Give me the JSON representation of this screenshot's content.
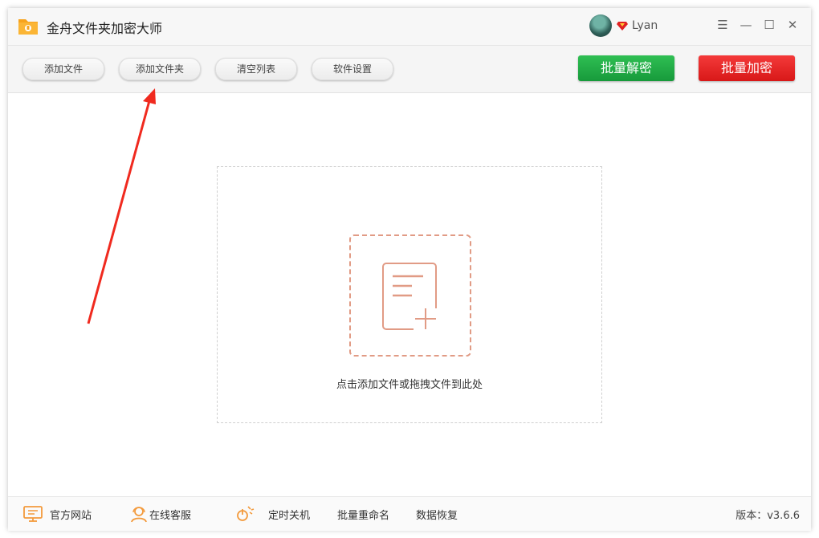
{
  "app": {
    "title": "金舟文件夹加密大师",
    "user": "Lyan"
  },
  "window_controls": {
    "menu": "☰",
    "minimize": "—",
    "maximize": "☐",
    "close": "✕"
  },
  "toolbar": {
    "add_file": "添加文件",
    "add_folder": "添加文件夹",
    "clear_list": "清空列表",
    "settings": "软件设置",
    "batch_decrypt": "批量解密",
    "batch_encrypt": "批量加密"
  },
  "main": {
    "drop_hint": "点击添加文件或拖拽文件到此处"
  },
  "footer": {
    "website": "官方网站",
    "support": "在线客服",
    "shutdown": "定时关机",
    "rename": "批量重命名",
    "recovery": "数据恢复",
    "version": "版本：v3.6.6"
  },
  "colors": {
    "accent_orange": "#e19b85",
    "decrypt_green": "#1fa845",
    "encrypt_red": "#e02222",
    "annotation_arrow": "#f02a1f"
  }
}
